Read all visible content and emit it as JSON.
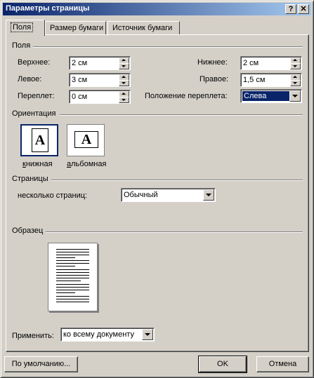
{
  "window": {
    "title": "Параметры страницы",
    "help_label": "?",
    "close_label": "✕"
  },
  "tabs": [
    {
      "label": "Поля",
      "active": true
    },
    {
      "label": "Размер бумаги",
      "active": false
    },
    {
      "label": "Источник бумаги",
      "active": false
    }
  ],
  "margins": {
    "group_title": "Поля",
    "top": {
      "label": "Верхнее:",
      "value": "2 см"
    },
    "bottom": {
      "label": "Нижнее:",
      "value": "2 см"
    },
    "left": {
      "label": "Левое:",
      "value": "3 см"
    },
    "right": {
      "label": "Правое:",
      "value": "1,5 см"
    },
    "gutter": {
      "label": "Переплет:",
      "value": "0 см"
    },
    "gutter_position": {
      "label": "Положение переплета:",
      "value": "Слева"
    }
  },
  "orientation": {
    "group_title": "Ориентация",
    "portrait": {
      "label": "книжная",
      "glyph": "A",
      "icon": "portrait-page-icon",
      "selected": true
    },
    "landscape": {
      "label": "альбомная",
      "glyph": "A",
      "icon": "landscape-page-icon",
      "selected": false
    }
  },
  "pages": {
    "group_title": "Страницы",
    "multiple_label": "несколько страниц:",
    "multiple_value": "Обычный"
  },
  "preview": {
    "group_title": "Образец"
  },
  "apply": {
    "label": "Применить:",
    "value": "ко всему документу"
  },
  "buttons": {
    "default": "По умолчанию...",
    "ok": "OK",
    "cancel": "Отмена"
  },
  "colors": {
    "title_start": "#0a246a",
    "title_end": "#a6caf0",
    "selection": "#0a246a",
    "face": "#d4d0c8"
  }
}
